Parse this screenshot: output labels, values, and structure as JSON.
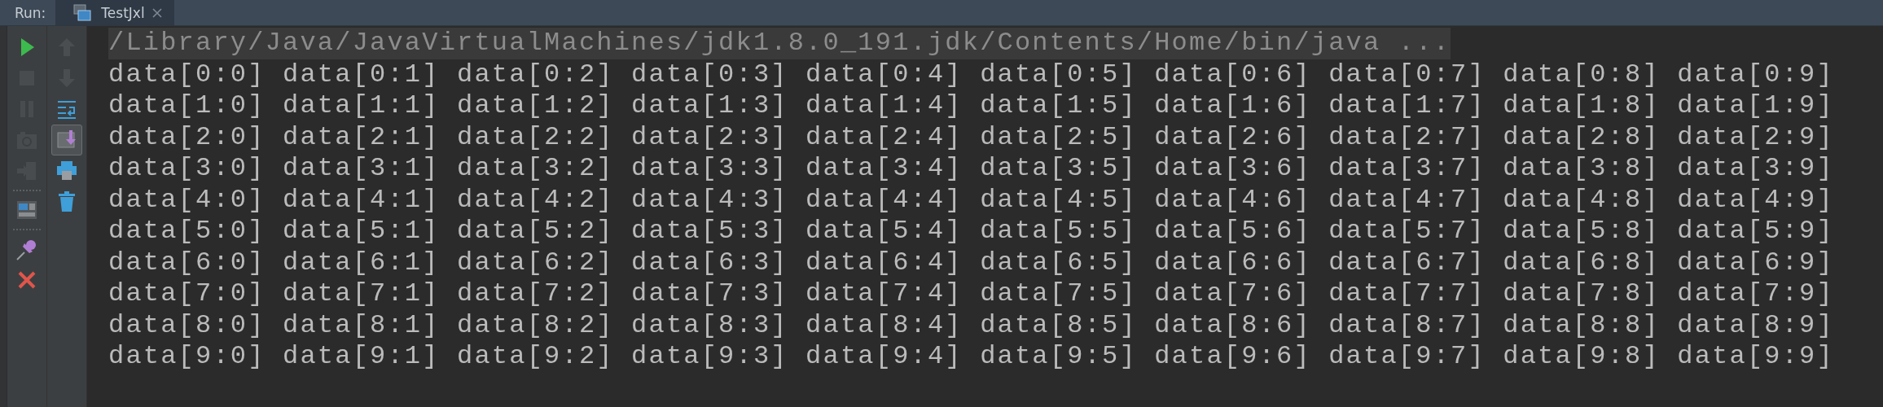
{
  "run_panel": {
    "label": "Run:",
    "tabs": [
      {
        "label": "TestJxl",
        "selected": true
      }
    ]
  },
  "left_toolbar": [
    {
      "buttons": [
        {
          "kind": "run",
          "disabled": false
        },
        {
          "kind": "stop",
          "disabled": true
        },
        {
          "kind": "pause",
          "disabled": true
        },
        {
          "kind": "camera",
          "disabled": true
        },
        {
          "kind": "exit",
          "disabled": true
        }
      ]
    },
    {
      "buttons": [
        {
          "kind": "layout",
          "disabled": false
        }
      ]
    },
    {
      "buttons": [
        {
          "kind": "pin",
          "disabled": false
        },
        {
          "kind": "close",
          "disabled": false
        }
      ]
    }
  ],
  "right_toolbar": [
    {
      "kind": "up",
      "disabled": true,
      "on": false
    },
    {
      "kind": "down",
      "disabled": true,
      "on": false
    },
    {
      "kind": "wrap",
      "disabled": false,
      "on": false
    },
    {
      "kind": "scroll-end",
      "disabled": false,
      "on": true
    },
    {
      "kind": "print",
      "disabled": false,
      "on": false
    },
    {
      "kind": "trash",
      "disabled": false,
      "on": false
    }
  ],
  "console": {
    "command": "/Library/Java/JavaVirtualMachines/jdk1.8.0_191.jdk/Contents/Home/bin/java ...",
    "lines": [
      "data[0:0] data[0:1] data[0:2] data[0:3] data[0:4] data[0:5] data[0:6] data[0:7] data[0:8] data[0:9]",
      "data[1:0] data[1:1] data[1:2] data[1:3] data[1:4] data[1:5] data[1:6] data[1:7] data[1:8] data[1:9]",
      "data[2:0] data[2:1] data[2:2] data[2:3] data[2:4] data[2:5] data[2:6] data[2:7] data[2:8] data[2:9]",
      "data[3:0] data[3:1] data[3:2] data[3:3] data[3:4] data[3:5] data[3:6] data[3:7] data[3:8] data[3:9]",
      "data[4:0] data[4:1] data[4:2] data[4:3] data[4:4] data[4:5] data[4:6] data[4:7] data[4:8] data[4:9]",
      "data[5:0] data[5:1] data[5:2] data[5:3] data[5:4] data[5:5] data[5:6] data[5:7] data[5:8] data[5:9]",
      "data[6:0] data[6:1] data[6:2] data[6:3] data[6:4] data[6:5] data[6:6] data[6:7] data[6:8] data[6:9]",
      "data[7:0] data[7:1] data[7:2] data[7:3] data[7:4] data[7:5] data[7:6] data[7:7] data[7:8] data[7:9]",
      "data[8:0] data[8:1] data[8:2] data[8:3] data[8:4] data[8:5] data[8:6] data[8:7] data[8:8] data[8:9]",
      "data[9:0] data[9:1] data[9:2] data[9:3] data[9:4] data[9:5] data[9:6] data[9:7] data[9:8] data[9:9]"
    ]
  }
}
